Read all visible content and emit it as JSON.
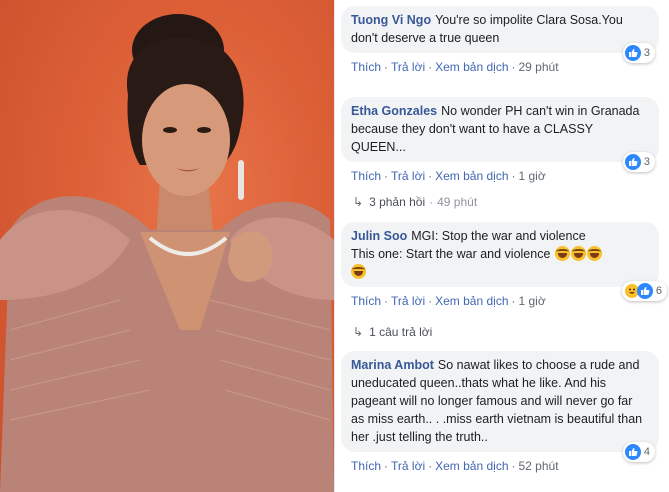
{
  "comments": [
    {
      "author": "Tuong Vi Ngo",
      "text": "You're so impolite Clara Sosa.You don't deserve a true queen",
      "actions": {
        "like": "Thích",
        "reply": "Trả lời",
        "translate": "Xem bản dịch",
        "time": "29 phút"
      },
      "reactions": {
        "count": "3"
      }
    },
    {
      "author": "Etha Gonzales",
      "text": "No wonder PH can't win in Granada because they don't want to have a CLASSY QUEEN...",
      "actions": {
        "like": "Thích",
        "reply": "Trả lời",
        "translate": "Xem bản dịch",
        "time": "1 giờ"
      },
      "reactions": {
        "count": "3"
      },
      "replies": {
        "count": "3 phản hồi",
        "time": "49 phút"
      }
    },
    {
      "author": "Julin Soo",
      "text_line1": "MGI: Stop the war and violence",
      "text_line2": "This one: Start the war and violence",
      "actions": {
        "like": "Thích",
        "reply": "Trả lời",
        "translate": "Xem bản dịch",
        "time": "1 giờ"
      },
      "reactions": {
        "count": "6"
      },
      "replies": {
        "count": "1 câu trả lời"
      }
    },
    {
      "author": "Marina Ambot",
      "text": "So nawat likes to choose a rude and uneducated queen..thats what he like. And his pageant will no longer famous and will never go far as miss earth.. . .miss earth vietnam is beautiful than her .just telling the truth..",
      "actions": {
        "like": "Thích",
        "reply": "Trả lời",
        "translate": "Xem bản dịch",
        "time": "52 phút"
      },
      "reactions": {
        "count": "4"
      }
    }
  ],
  "icons": {
    "like": "like-icon",
    "haha": "haha-icon",
    "reply_arrow": "reply-arrow-icon"
  },
  "colors": {
    "name": "#385898",
    "link": "#4267b2",
    "bubble": "#f2f3f5",
    "photo_bg": "#dc5f36",
    "like": "#2d88ff"
  }
}
